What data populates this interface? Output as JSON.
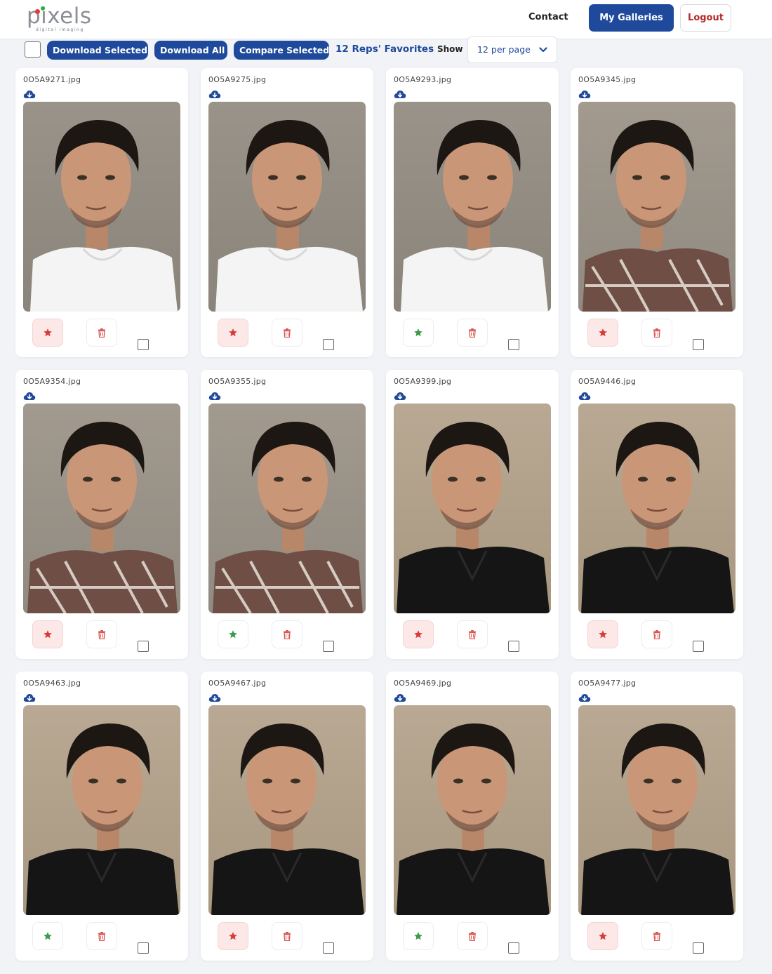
{
  "header": {
    "logo_text": "pixels",
    "logo_tagline": "digital imaging",
    "nav_contact": "Contact",
    "nav_galleries": "My Galleries",
    "nav_logout": "Logout"
  },
  "toolbar": {
    "download_selected": "Download Selected",
    "download_all": "Download All",
    "compare_selected": "Compare Selected",
    "favorites_link": "12 Reps' Favorites",
    "show_label": "Show",
    "per_page_value": "12 per page"
  },
  "colors": {
    "primary": "#1f4a9b",
    "favorite_red": "#d93a3a",
    "favorite_green": "#3a9a4a",
    "delete_red": "#d9534f"
  },
  "photos": [
    {
      "filename": "0O5A9271.jpg",
      "star_color": "red",
      "star_active": true,
      "scene": "white-tee"
    },
    {
      "filename": "0O5A9275.jpg",
      "star_color": "red",
      "star_active": true,
      "scene": "white-tee"
    },
    {
      "filename": "0O5A9293.jpg",
      "star_color": "green",
      "star_active": false,
      "scene": "white-tee"
    },
    {
      "filename": "0O5A9345.jpg",
      "star_color": "red",
      "star_active": true,
      "scene": "plaid"
    },
    {
      "filename": "0O5A9354.jpg",
      "star_color": "red",
      "star_active": true,
      "scene": "plaid"
    },
    {
      "filename": "0O5A9355.jpg",
      "star_color": "green",
      "star_active": false,
      "scene": "plaid"
    },
    {
      "filename": "0O5A9399.jpg",
      "star_color": "red",
      "star_active": true,
      "scene": "black-jacket"
    },
    {
      "filename": "0O5A9446.jpg",
      "star_color": "red",
      "star_active": true,
      "scene": "black-jacket"
    },
    {
      "filename": "0O5A9463.jpg",
      "star_color": "green",
      "star_active": false,
      "scene": "black-jacket"
    },
    {
      "filename": "0O5A9467.jpg",
      "star_color": "red",
      "star_active": true,
      "scene": "black-jacket"
    },
    {
      "filename": "0O5A9469.jpg",
      "star_color": "green",
      "star_active": false,
      "scene": "black-jacket"
    },
    {
      "filename": "0O5A9477.jpg",
      "star_color": "red",
      "star_active": true,
      "scene": "black-jacket"
    }
  ]
}
